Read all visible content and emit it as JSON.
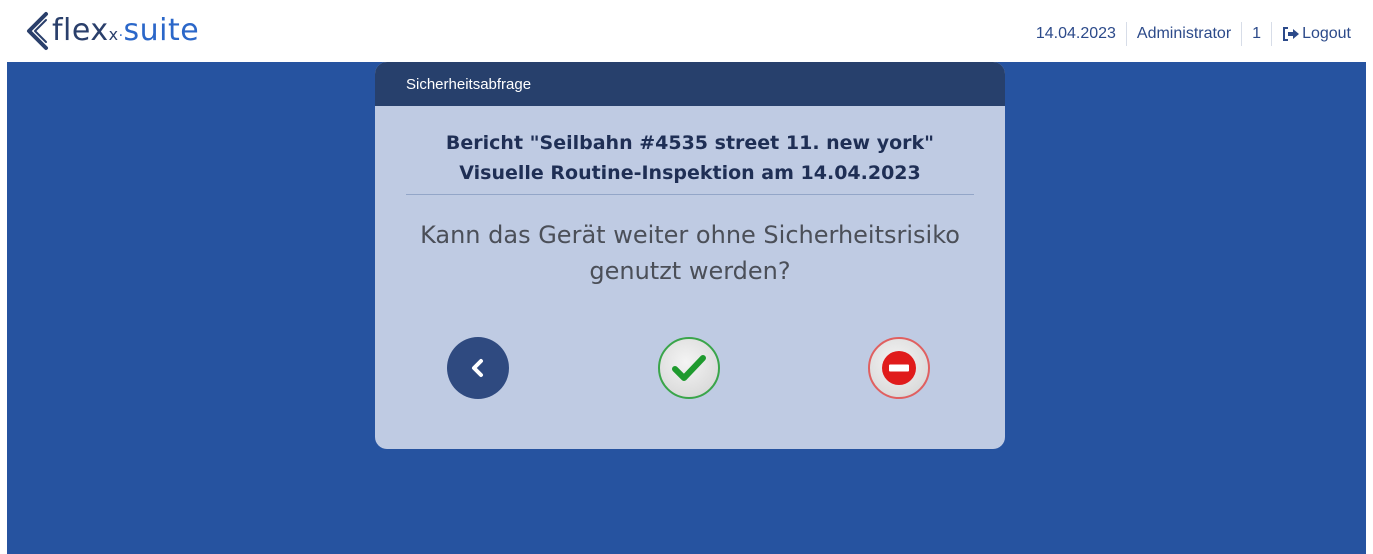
{
  "header": {
    "logo_text_flex": "flex",
    "logo_text_x": "x",
    "logo_text_dot": "·",
    "logo_text_suite": "suite",
    "date": "14.04.2023",
    "user": "Administrator",
    "count": "1",
    "logout_label": "Logout"
  },
  "dialog": {
    "title": "Sicherheitsabfrage",
    "report_line1": "Bericht \"Seilbahn #4535 street 11. new york\"",
    "report_line2": "Visuelle Routine-Inspektion am 14.04.2023",
    "question_line1": "Kann das Gerät weiter ohne Sicherheitsrisiko",
    "question_line2": "genutzt werden?",
    "buttons": {
      "back_icon": "chevron-left-icon",
      "confirm_icon": "check-icon",
      "deny_icon": "no-entry-icon"
    }
  },
  "colors": {
    "background": "#2653a0",
    "dialog_bg": "#bfcbe3",
    "dialog_header": "#27406c",
    "confirm": "#1e9a2e",
    "deny": "#e01b1b"
  }
}
